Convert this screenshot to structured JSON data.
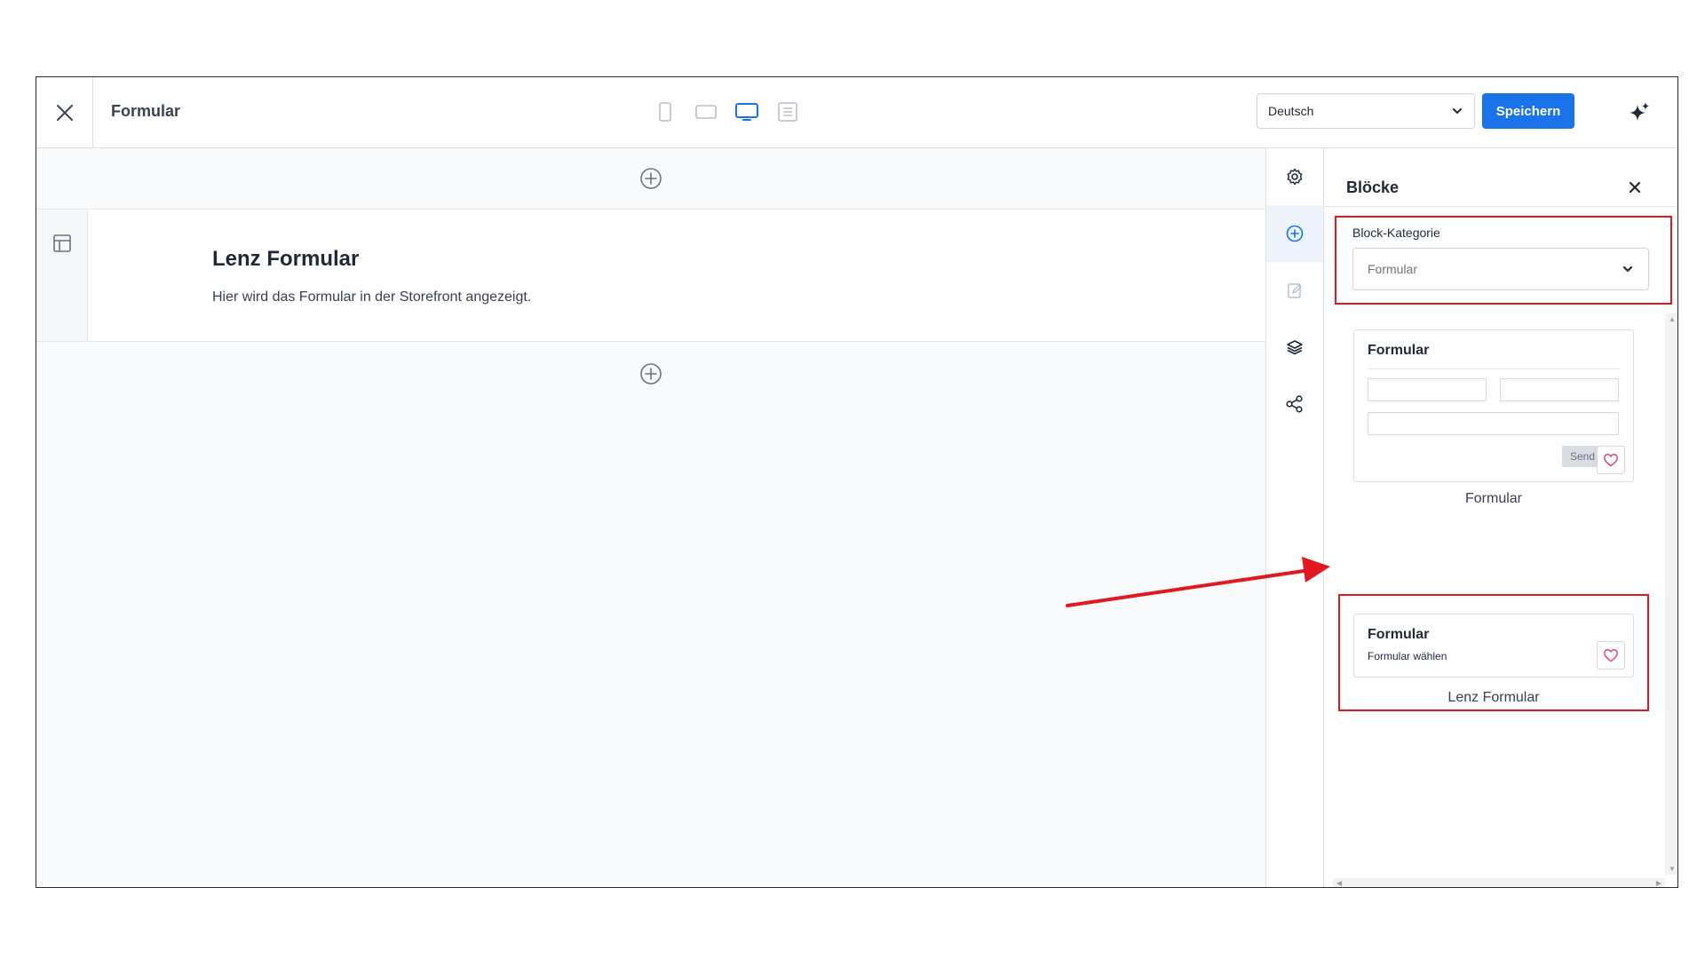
{
  "header": {
    "title": "Formular",
    "language": "Deutsch",
    "save_label": "Speichern",
    "device_active": "desktop"
  },
  "canvas": {
    "block_title": "Lenz Formular",
    "block_text": "Hier wird das Formular in der Storefront angezeigt."
  },
  "panel": {
    "title": "Blöcke",
    "category_label": "Block-Kategorie",
    "category_value": "Formular",
    "cards": [
      {
        "title": "Formular",
        "send": "Send",
        "caption": "Formular"
      },
      {
        "title": "Formular",
        "subtitle": "Formular wählen",
        "caption": "Lenz Formular"
      }
    ]
  },
  "colors": {
    "accent": "#1a73e8",
    "highlight": "#e0191f",
    "heart": "#e0457b"
  }
}
